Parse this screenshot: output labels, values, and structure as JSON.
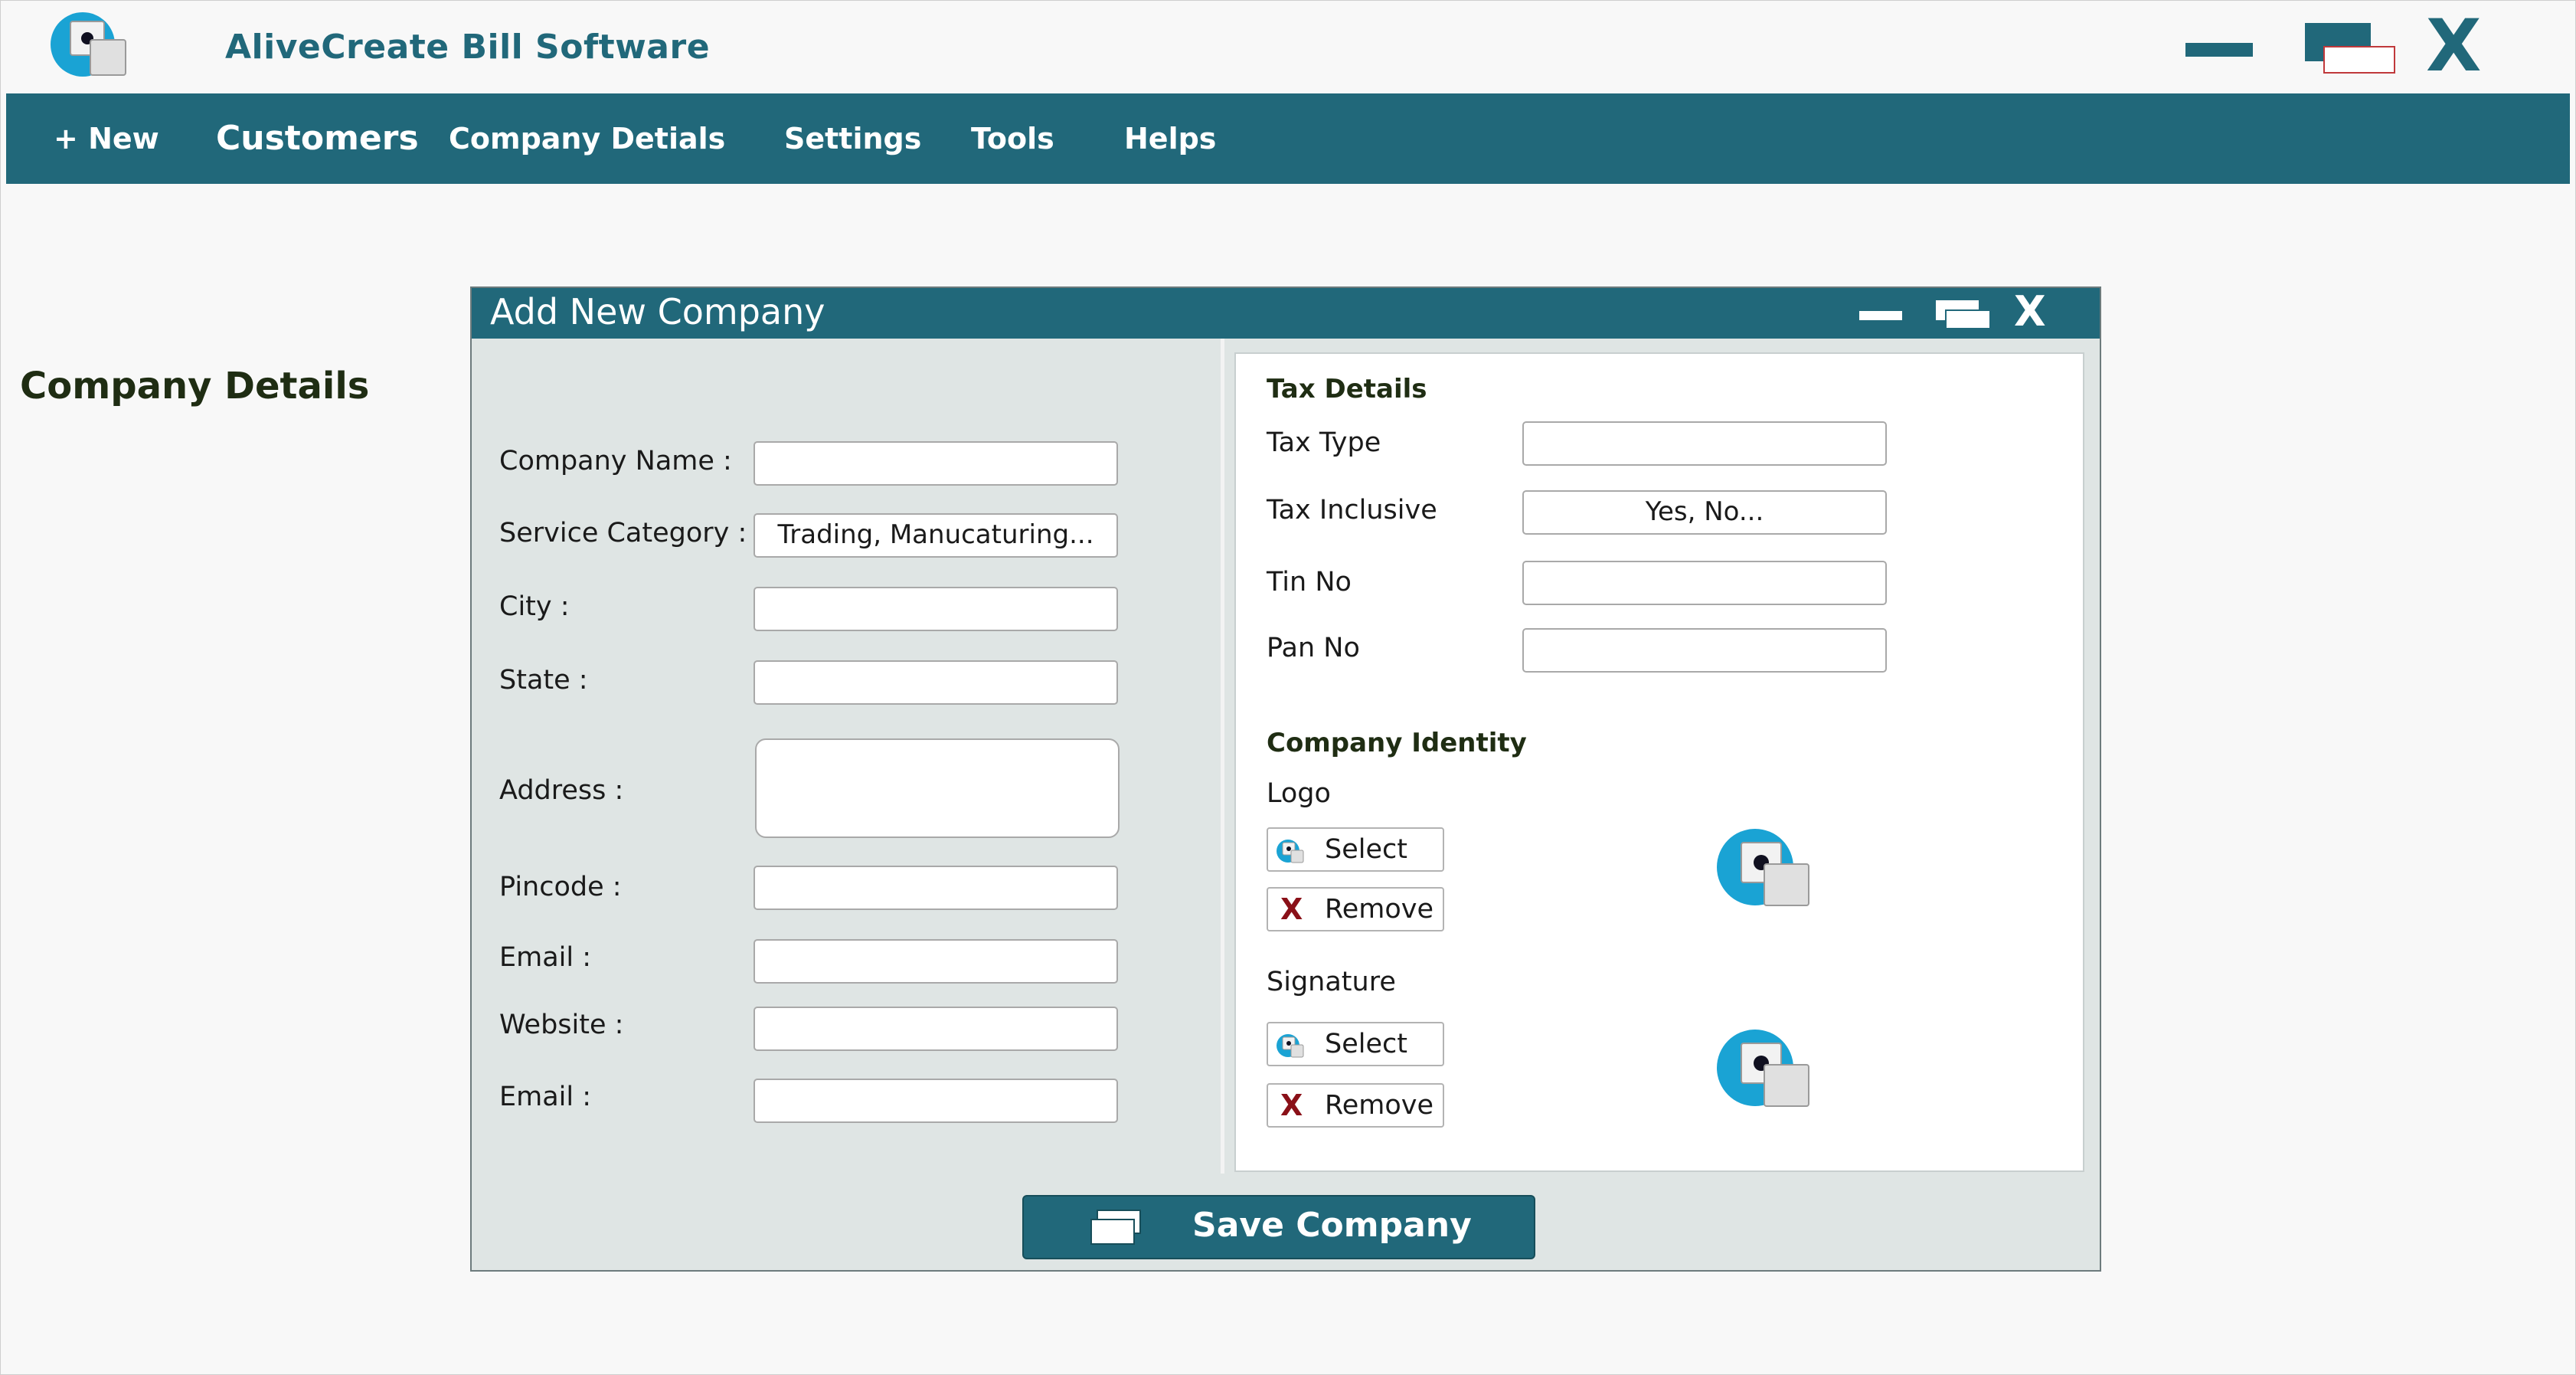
{
  "app": {
    "title": "AliveCreate Bill Software",
    "window_controls": {
      "close_glyph": "X"
    }
  },
  "menu": {
    "items": [
      "+ New",
      "Customers",
      "Company Detials",
      "Settings",
      "Tools",
      "Helps"
    ]
  },
  "dialog": {
    "title": "Add New Company",
    "close_glyph": "X",
    "company_details": {
      "heading": "Company Details",
      "fields": [
        {
          "label": "Company Name :",
          "value": ""
        },
        {
          "label": "Service Category :",
          "value": "Trading, Manucaturing..."
        },
        {
          "label": "City :",
          "value": ""
        },
        {
          "label": "State :",
          "value": ""
        },
        {
          "label": "Address :",
          "value": ""
        },
        {
          "label": "Pincode :",
          "value": ""
        },
        {
          "label": "Email :",
          "value": ""
        },
        {
          "label": "Website :",
          "value": ""
        },
        {
          "label": "Email :",
          "value": ""
        }
      ]
    },
    "tax_details": {
      "heading": "Tax Details",
      "fields": [
        {
          "label": "Tax Type",
          "value": ""
        },
        {
          "label": "Tax Inclusive",
          "value": "Yes, No..."
        },
        {
          "label": "Tin No",
          "value": ""
        },
        {
          "label": "Pan No",
          "value": ""
        }
      ]
    },
    "company_identity": {
      "heading": "Company Identity",
      "logo": {
        "label": "Logo",
        "select": "Select",
        "remove": "Remove",
        "remove_glyph": "X"
      },
      "signature": {
        "label": "Signature",
        "select": "Select",
        "remove": "Remove",
        "remove_glyph": "X"
      }
    },
    "save_label": "Save Company"
  },
  "colors": {
    "brand": "#21687a",
    "accent_blue": "#1aa3d4",
    "remove_red": "#8a1018"
  }
}
